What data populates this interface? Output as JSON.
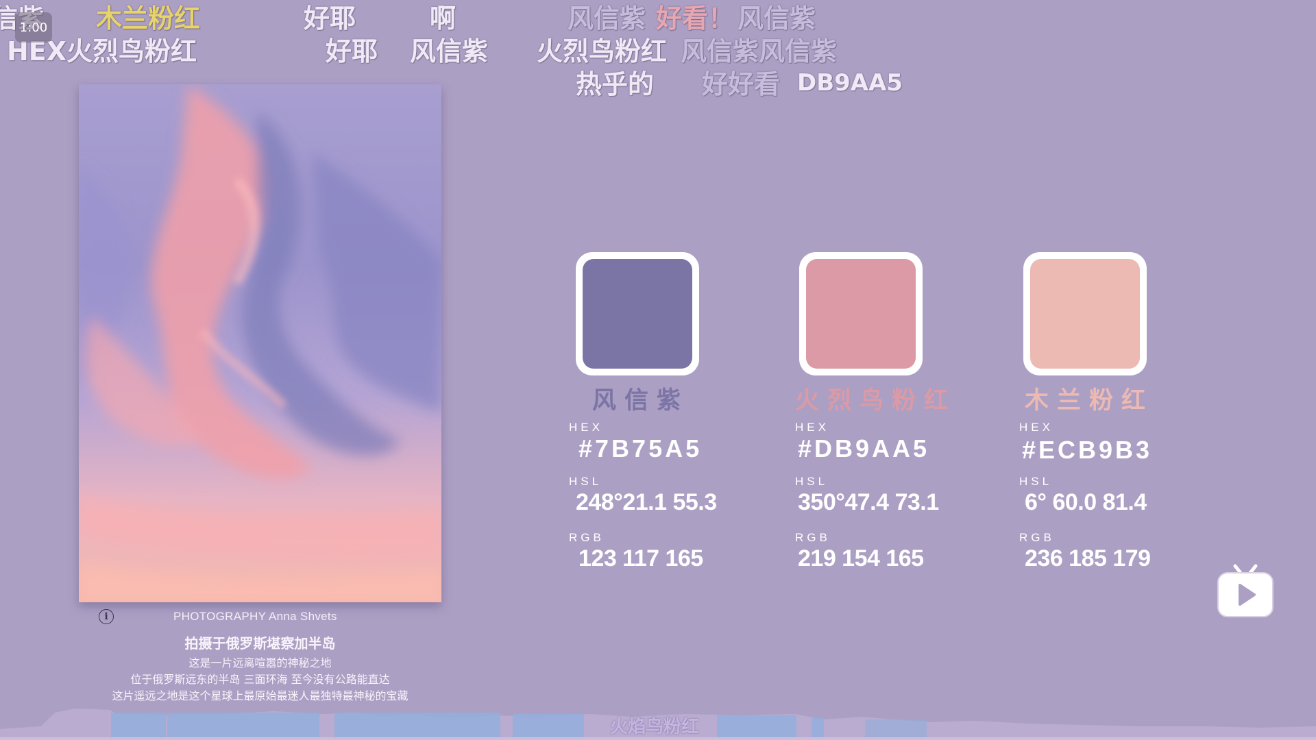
{
  "player": {
    "time_badge": "1:00"
  },
  "danmaku": [
    {
      "text": "信紫",
      "color": "#f0eaf6"
    },
    {
      "text": "木兰粉红",
      "color": "#e6d36a"
    },
    {
      "text": "好耶",
      "color": "#f0eaf6"
    },
    {
      "text": "啊",
      "color": "#f0eaf6"
    },
    {
      "text": "风信紫",
      "color": "#c8bcdc"
    },
    {
      "text": "好看！",
      "color": "#e8a6b0"
    },
    {
      "text": "风信紫",
      "color": "#c8bcdc"
    },
    {
      "text": "HEX火烈鸟粉红",
      "color": "#f0eaf6"
    },
    {
      "text": "好耶",
      "color": "#f0eaf6"
    },
    {
      "text": "风信紫",
      "color": "#f0eaf6"
    },
    {
      "text": "火烈鸟粉红",
      "color": "#f0eaf6"
    },
    {
      "text": "风信紫风信紫",
      "color": "#c8bcdc"
    },
    {
      "text": "热乎的",
      "color": "#f0eaf6"
    },
    {
      "text": "好好看",
      "color": "#c8bcdc"
    },
    {
      "text": "DB9AA5",
      "color": "#f0eaf6"
    }
  ],
  "photo": {
    "info_icon": "info-icon",
    "credit": "PHOTOGRAPHY  Anna Shvets",
    "caption_title": "拍摄于俄罗斯堪察加半岛",
    "caption_lines": [
      "这是一片远离喧嚣的神秘之地",
      "位于俄罗斯远东的半岛  三面环海  至今没有公路能直达",
      "这片遥远之地是这个星球上最原始最迷人最独特最神秘的宝藏"
    ]
  },
  "colors": [
    {
      "name": "风信紫",
      "name_color": "#7b75a5",
      "swatch": "#7b75a5",
      "hex_label": "HEX",
      "hex": "#7B75A5",
      "hsl_label": "HSL",
      "hsl": "248°21.1 55.3",
      "rgb_label": "RGB",
      "rgb": "123  117  165"
    },
    {
      "name": "火烈鸟粉红",
      "name_color": "#db9aa5",
      "swatch": "#db9aa5",
      "hex_label": "HEX",
      "hex": "#DB9AA5",
      "hsl_label": "HSL",
      "hsl": "350°47.4  73.1",
      "rgb_label": "RGB",
      "rgb": "219  154  165"
    },
    {
      "name": "木兰粉红",
      "name_color": "#ecb9b3",
      "swatch": "#ecb9b3",
      "hex_label": "HEX",
      "hex": "#ECB9B3",
      "hsl_label": "HSL",
      "hsl": "6°  60.0  81.4",
      "rgb_label": "RGB",
      "rgb": "236  185  179"
    }
  ],
  "controls": {
    "tv_icon": "bilibili-tv-icon"
  },
  "bottom": {
    "label": "火焰鸟粉红"
  }
}
